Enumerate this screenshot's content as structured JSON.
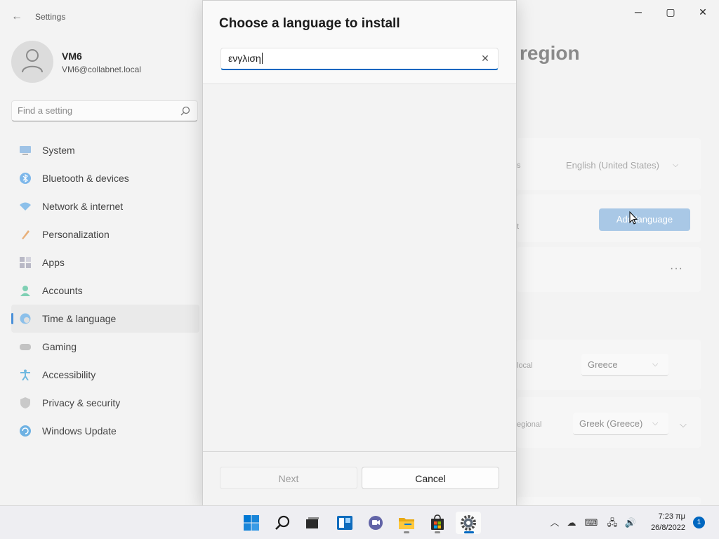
{
  "window": {
    "app_title": "Settings",
    "controls": {
      "minimize": "─",
      "maximize": "▢",
      "close": "✕"
    }
  },
  "profile": {
    "name": "VM6",
    "email": "VM6@collabnet.local"
  },
  "search": {
    "placeholder": "Find a setting"
  },
  "sidebar": {
    "items": [
      {
        "label": "System",
        "icon": "monitor-icon",
        "active": false
      },
      {
        "label": "Bluetooth & devices",
        "icon": "bluetooth-icon",
        "active": false
      },
      {
        "label": "Network & internet",
        "icon": "wifi-icon",
        "active": false
      },
      {
        "label": "Personalization",
        "icon": "brush-icon",
        "active": false
      },
      {
        "label": "Apps",
        "icon": "apps-icon",
        "active": false
      },
      {
        "label": "Accounts",
        "icon": "person-icon",
        "active": false
      },
      {
        "label": "Time & language",
        "icon": "globe-clock-icon",
        "active": true
      },
      {
        "label": "Gaming",
        "icon": "gamepad-icon",
        "active": false
      },
      {
        "label": "Accessibility",
        "icon": "accessibility-icon",
        "active": false
      },
      {
        "label": "Privacy & security",
        "icon": "shield-icon",
        "active": false
      },
      {
        "label": "Windows Update",
        "icon": "update-icon",
        "active": false
      }
    ]
  },
  "background_page": {
    "title_fragment": "region",
    "windows_display_fragment": "s",
    "windows_display_value": "English (United States)",
    "preferred_fragment": "t",
    "add_language_label": "Add language",
    "more_label": "···",
    "region_fragment": "local",
    "region_value": "Greece",
    "format_fragment": "egional",
    "format_value": "Greek (Greece)"
  },
  "dialog": {
    "title": "Choose a language to install",
    "search_value": "ενγλιση",
    "clear_label": "✕",
    "next_label": "Next",
    "cancel_label": "Cancel"
  },
  "taskbar": {
    "apps": [
      "windows-start-icon",
      "search-icon",
      "task-view-icon",
      "widgets-icon",
      "teams-chat-icon",
      "file-explorer-icon",
      "microsoft-store-icon",
      "settings-icon"
    ],
    "clock_time": "7:23 πμ",
    "clock_date": "26/8/2022",
    "notification_count": "1"
  },
  "colors": {
    "accent": "#0067c0",
    "background": "#f3f3f3",
    "disabled_button_text": "#9c9c9c"
  }
}
